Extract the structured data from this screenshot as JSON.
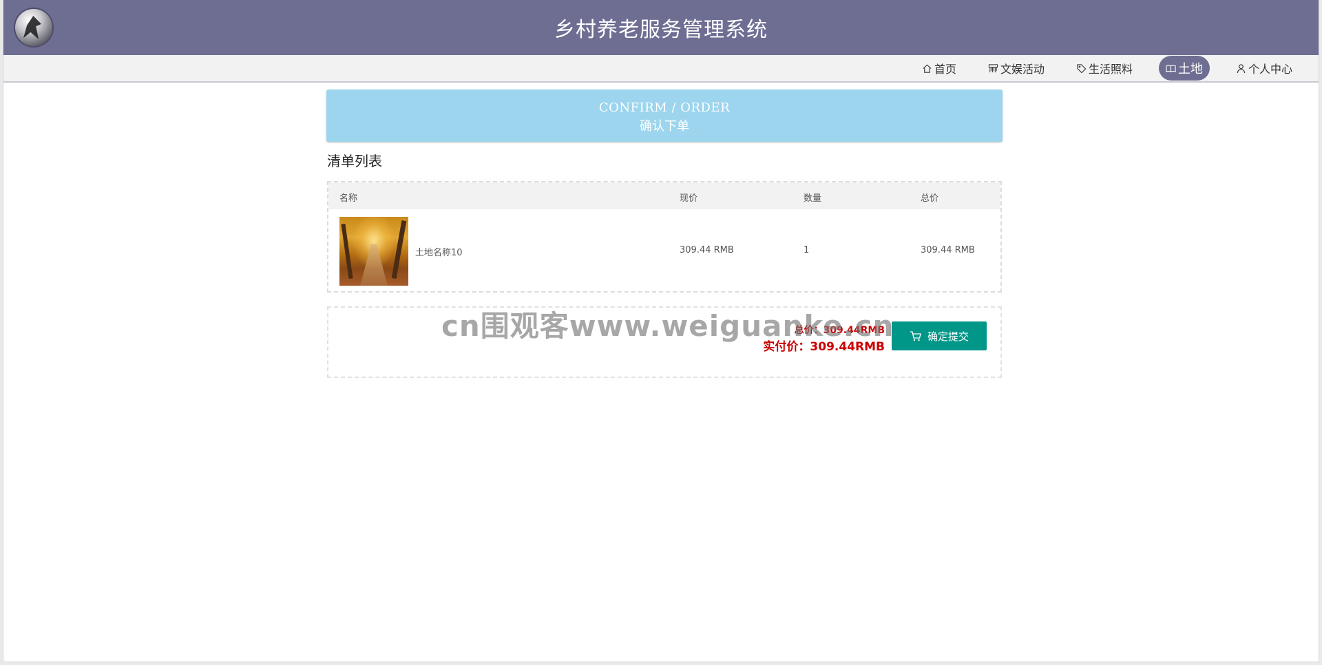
{
  "header": {
    "title": "乡村养老服务管理系统",
    "logo_icon": "bird-logo-icon"
  },
  "nav": {
    "items": [
      {
        "label": "首页",
        "icon": "home-icon",
        "active": false
      },
      {
        "label": "文娱活动",
        "icon": "grid-icon",
        "active": false
      },
      {
        "label": "生活照料",
        "icon": "tag-icon",
        "active": false
      },
      {
        "label": "土地",
        "icon": "book-icon",
        "active": true
      },
      {
        "label": "个人中心",
        "icon": "user-icon",
        "active": false
      }
    ],
    "active_color": "#6e6d92"
  },
  "banner": {
    "title_en": "CONFIRM / ORDER",
    "title_cn": "确认下单",
    "color": "#9dd5ee"
  },
  "section": {
    "title": "清单列表"
  },
  "table": {
    "headers": [
      "名称",
      "现价",
      "数量",
      "总价"
    ],
    "rows": [
      {
        "name": "土地名称10",
        "price": "309.44 RMB",
        "quantity": "1",
        "total": "309.44 RMB"
      }
    ]
  },
  "summary": {
    "total_text": "总价：309.44RMB",
    "paid_text": "实付价：309.44RMB",
    "submit_label": "确定提交",
    "submit_icon": "cart-icon",
    "button_color": "#009688",
    "price_color": "#cc0000"
  },
  "watermark": {
    "text": "cn围观客www.weiguanke.cn"
  }
}
